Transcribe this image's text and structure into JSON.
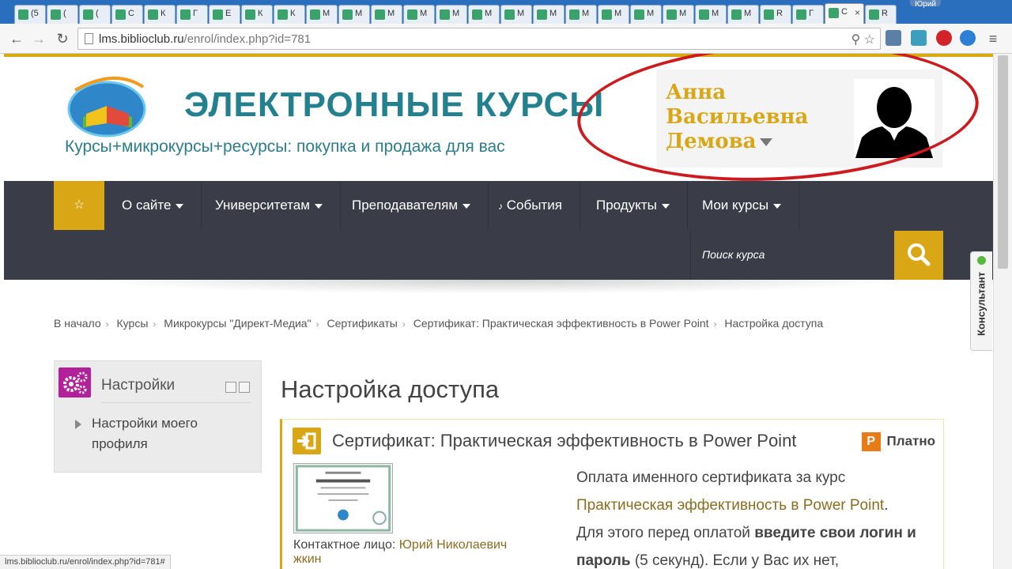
{
  "browser": {
    "tabs": [
      {
        "label": "(5"
      },
      {
        "label": "("
      },
      {
        "label": "("
      },
      {
        "label": "С"
      },
      {
        "label": "К"
      },
      {
        "label": "Г"
      },
      {
        "label": "Е"
      },
      {
        "label": "К"
      },
      {
        "label": "К"
      },
      {
        "label": "М"
      },
      {
        "label": "М"
      },
      {
        "label": "М"
      },
      {
        "label": "М"
      },
      {
        "label": "М"
      },
      {
        "label": "М"
      },
      {
        "label": "М"
      },
      {
        "label": "М"
      },
      {
        "label": "М"
      },
      {
        "label": "М"
      },
      {
        "label": "М"
      },
      {
        "label": "М"
      },
      {
        "label": "М"
      },
      {
        "label": "М"
      },
      {
        "label": "R"
      },
      {
        "label": "Г"
      },
      {
        "label": "С"
      },
      {
        "label": "R"
      }
    ],
    "active_tab_label": "С",
    "window_user": "Юрий",
    "url_host": "lms.biblioclub.ru",
    "url_path": "/enrol/index.php?id=781",
    "status_url": "lms.biblioclub.ru/enrol/index.php?id=781#"
  },
  "header": {
    "logo_title": "ЭЛЕКТРОННЫЕ КУРСЫ",
    "logo_subtitle": "Курсы+микрокурсы+ресурсы: покупка и продажа для вас",
    "user_first": "Анна",
    "user_middle": "Васильевна",
    "user_last": "Демова"
  },
  "nav": {
    "star": "☆",
    "items": [
      {
        "label": "О сайте"
      },
      {
        "label": "Университетам"
      },
      {
        "label": "Преподавателям"
      },
      {
        "label": "События"
      },
      {
        "label": "Продукты"
      },
      {
        "label": "Мои курсы"
      }
    ],
    "search_placeholder": "Поиск курса"
  },
  "breadcrumb": [
    {
      "label": "В начало"
    },
    {
      "label": "Курсы"
    },
    {
      "label": "Микрокурсы \"Директ-Медиа\""
    },
    {
      "label": "Сертификаты"
    },
    {
      "label": "Сертификат: Практическая эффективность в Power Point"
    },
    {
      "label": "Настройка доступа"
    }
  ],
  "settings_block": {
    "title": "Настройки",
    "link": "Настройки моего профиля"
  },
  "main": {
    "page_title": "Настройка доступа",
    "course_title": "Сертификат: Практическая эффективность в Power Point",
    "paid_label": "Платно",
    "paid_icon": "Р",
    "contact_label": "Контактное лицо:",
    "contact_name": "Юрий Николаевич",
    "contact_name_2": "жкин",
    "desc_1": "Оплата именного сертификата за курс",
    "desc_link": "Практическая эффективность в Power Point",
    "desc_2": "Для этого перед оплатой",
    "desc_bold": "введите свои логин и пароль",
    "desc_3": "(5 секунд). Если у Вас их нет,"
  },
  "widget": {
    "consult_label": "Консультант"
  },
  "colors": {
    "accent": "#d9a716",
    "nav_bg": "#3a3d48",
    "annotation": "#cc1a1e",
    "brand_teal": "#23808e"
  }
}
